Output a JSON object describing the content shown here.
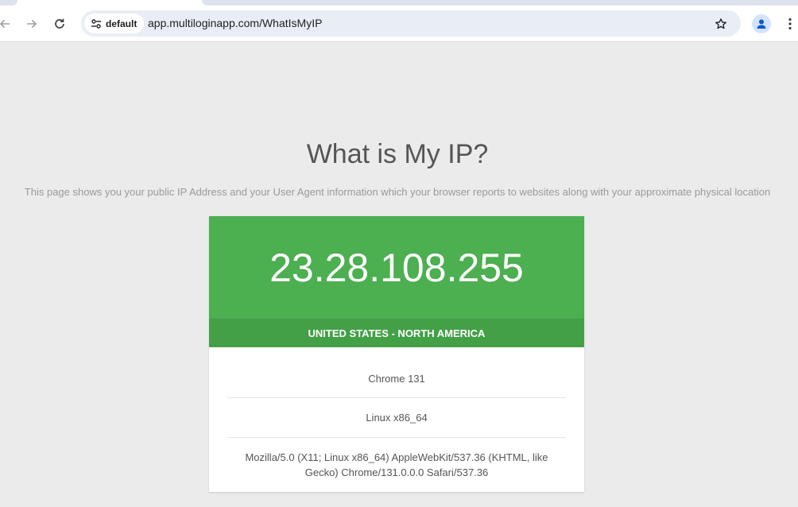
{
  "browser": {
    "profile_chip_label": "default",
    "url": "app.multiloginapp.com/WhatIsMyIP"
  },
  "page": {
    "title": "What is My IP?",
    "description": "This page shows you your public IP Address and your User Agent information which your browser reports to websites along with your approximate physical location",
    "ip_address": "23.28.108.255",
    "region": "UNITED STATES - NORTH AMERICA",
    "browser_info": "Chrome 131",
    "platform": "Linux x86_64",
    "user_agent": "Mozilla/5.0 (X11; Linux x86_64) AppleWebKit/537.36 (KHTML, like Gecko) Chrome/131.0.0.0 Safari/537.36"
  },
  "colors": {
    "ip_box": "#4caf50",
    "region_bar": "#43a047",
    "page_background": "#ebebeb"
  },
  "icons": [
    "back-arrow-icon",
    "forward-arrow-icon",
    "reload-icon",
    "site-settings-icon",
    "star-icon",
    "profile-icon",
    "kebab-menu-icon"
  ]
}
